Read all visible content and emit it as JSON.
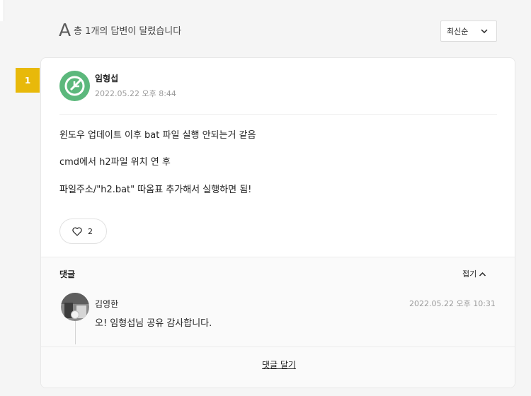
{
  "header": {
    "a_mark": "A",
    "answer_count_text": "총 1개의 답변이 달렸습니다",
    "sort": {
      "selected": "최신순",
      "icon": "chevron-down-icon"
    }
  },
  "answer": {
    "rank": "1",
    "author": "임형섭",
    "date": "2022.05.22 오후 8:44",
    "avatar": {
      "icon": "leaf-avatar-icon",
      "color": "#5cb87c"
    },
    "body": [
      "윈도우 업데이트 이후 bat 파일 실행 안되는거 같음",
      "cmd에서 h2파일 위치 연 후",
      "파일주소/\"h2.bat\"  따옴표 추가해서 실행하면 됨!"
    ],
    "likes": {
      "icon": "heart-icon",
      "count": "2"
    }
  },
  "comments": {
    "title": "댓글",
    "collapse_label": "접기",
    "collapse_icon": "chevron-up-icon",
    "items": [
      {
        "author": "김영한",
        "date": "2022.05.22 오후 10:31",
        "text": "오! 임형섭님 공유 감사합니다."
      }
    ],
    "write_label": "댓글 달기"
  },
  "colors": {
    "badge": "#e8b90a",
    "accent_green": "#5cb87c"
  }
}
